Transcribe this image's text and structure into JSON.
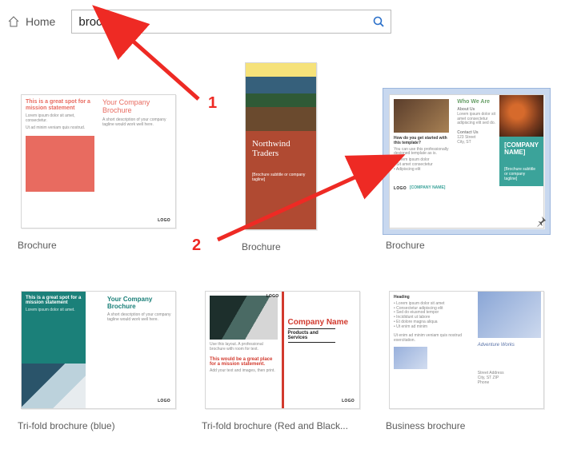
{
  "header": {
    "home_label": "Home"
  },
  "search": {
    "value": "brochure",
    "placeholder": ""
  },
  "annotations": {
    "num1": "1",
    "num2": "2"
  },
  "templates": [
    {
      "caption": "Brochure",
      "kind": "red-trifold",
      "tagline": "This is a great spot for a mission statement",
      "title": "Your Company Brochure",
      "logo": "LOGO"
    },
    {
      "caption": "Brochure",
      "kind": "northwind",
      "title": "Northwind Traders",
      "subtitle": "[Brochure subtitle or company tagline]"
    },
    {
      "caption": "Brochure",
      "kind": "teal-trifold",
      "heading": "Who We Are",
      "sub1": "About Us",
      "sub2": "Contact Us",
      "q": "How do you get started with this template?",
      "company": "[COMPANY NAME]",
      "company_small": "[COMPANY NAME]",
      "subtitle": "[Brochure subtitle or company tagline]",
      "logo": "LOGO",
      "selected": true
    },
    {
      "caption": "Tri-fold brochure (blue)",
      "kind": "blue-trifold",
      "tagline": "This is a great spot for a mission statement",
      "title": "Your Company Brochure",
      "logo": "LOGO"
    },
    {
      "caption": "Tri-fold brochure (Red and Black...",
      "kind": "redblack-trifold",
      "tagline": "This would be a great place for a mission statement.",
      "company": "Company Name",
      "ps": "Products and Services",
      "logo_top": "LOGO",
      "logo_bottom": "LOGO"
    },
    {
      "caption": "Business brochure",
      "kind": "business",
      "adv": "Adventure Works"
    }
  ]
}
